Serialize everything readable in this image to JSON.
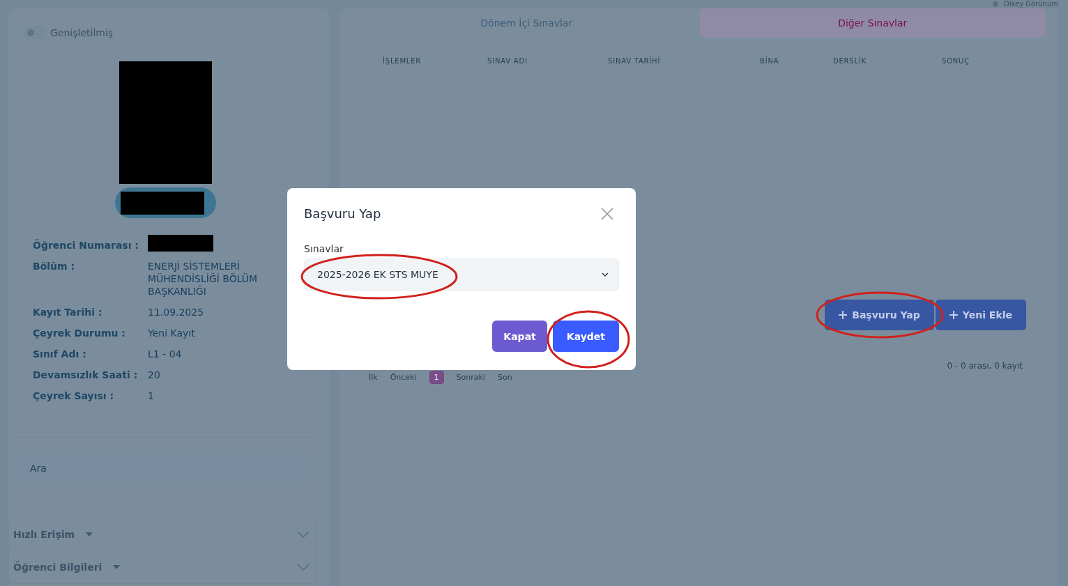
{
  "view_toggle": {
    "label": "Dikey Görünüm",
    "on": false
  },
  "sidebar": {
    "expanded_toggle": {
      "label": "Genişletilmiş",
      "on": false
    },
    "info": [
      {
        "label": "Öğrenci Numarası :",
        "redacted": true
      },
      {
        "label": "Bölüm :",
        "value": "ENERJİ SİSTEMLERİ MÜHENDİSLİĞİ BÖLÜM BAŞKANLIĞI"
      },
      {
        "label": "Kayıt Tarihi :",
        "value": "11.09.2025"
      },
      {
        "label": "Çeyrek Durumu :",
        "value": "Yeni Kayıt"
      },
      {
        "label": "Sınıf Adı :",
        "value": "L1 - 04"
      },
      {
        "label": "Devamsızlık Saati :",
        "value": "20"
      },
      {
        "label": "Çeyrek Sayısı :",
        "value": "1"
      }
    ],
    "search": {
      "placeholder": "Ara"
    },
    "accordion": [
      {
        "label": "Hızlı Erişim",
        "expanded": false
      },
      {
        "label": "Öğrenci Bilgileri",
        "expanded": false
      }
    ]
  },
  "tabs": [
    {
      "label": "Dönem İçi Sınavlar",
      "selected": false
    },
    {
      "label": "Diğer Sınavlar",
      "selected": true
    }
  ],
  "table": {
    "columns": [
      "İŞLEMLER",
      "SINAV ADI",
      "SINAV TARİHİ",
      "BİNA",
      "DERSLİK",
      "SONUÇ"
    ]
  },
  "actions": [
    {
      "label": "Başvuru Yap",
      "highlighted": true
    },
    {
      "label": "Yeni Ekle",
      "highlighted": false
    }
  ],
  "pagination": [
    {
      "label": "İlk",
      "kind": "nav",
      "selected": false
    },
    {
      "label": "Önceki",
      "kind": "nav",
      "selected": false
    },
    {
      "label": "1",
      "kind": "page",
      "selected": true
    },
    {
      "label": "Sonraki",
      "kind": "nav",
      "selected": false
    },
    {
      "label": "Son",
      "kind": "nav",
      "selected": false
    }
  ],
  "summary": "0 - 0 arası, 0 kayıt",
  "modal": {
    "title": "Başvuru Yap",
    "field_label": "Sınavlar",
    "value": "2025-2026 EK STS MUYE",
    "value_highlighted": true,
    "buttons": [
      {
        "label": "Kapat",
        "kind": "secondary",
        "highlighted": false
      },
      {
        "label": "Kaydet",
        "kind": "primary",
        "highlighted": true
      }
    ]
  }
}
